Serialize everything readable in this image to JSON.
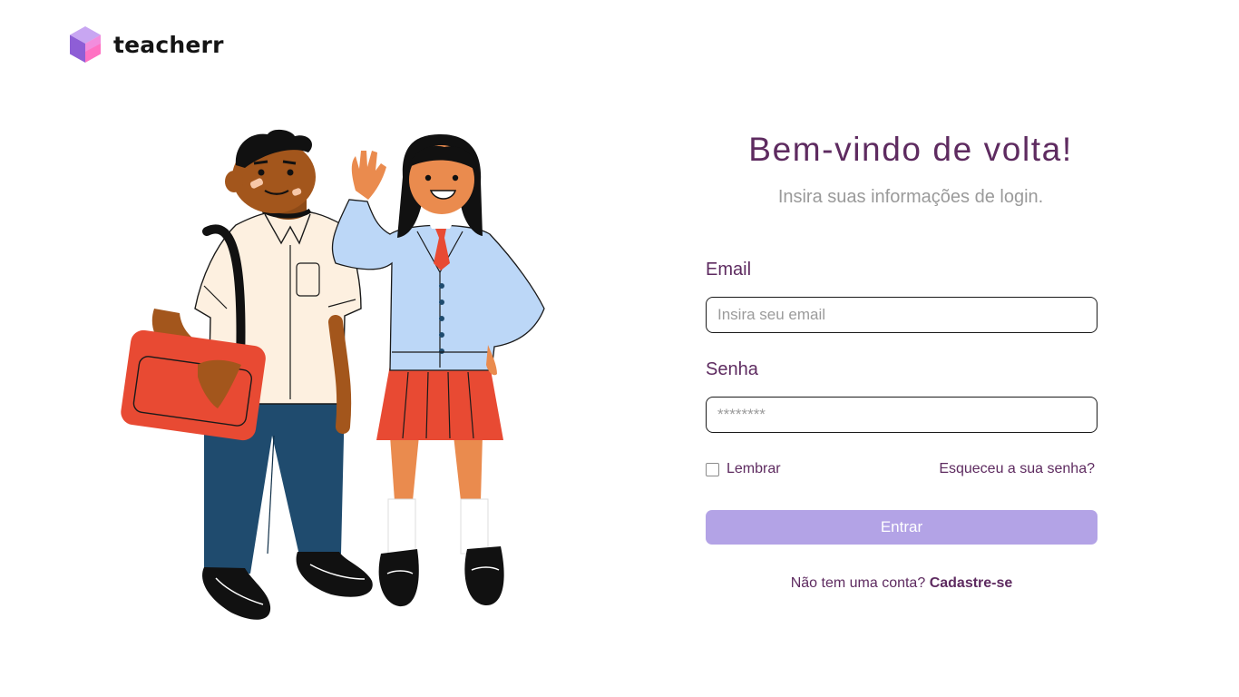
{
  "brand": {
    "name": "teacherr",
    "logo_icon": "cube-logo-icon",
    "logo_colors": [
      "#c39bf0",
      "#8f5fd8",
      "#ff6fc2"
    ]
  },
  "illustration": {
    "description_icon": "students-illustration"
  },
  "login": {
    "title": "Bem-vindo de volta!",
    "subtitle": "Insira suas informações de login.",
    "email_label": "Email",
    "email_placeholder": "Insira seu email",
    "email_value": "",
    "password_label": "Senha",
    "password_placeholder": "********",
    "password_value": "",
    "remember_label": "Lembrar",
    "remember_checked": false,
    "forgot_link": "Esqueceu a sua senha?",
    "submit_label": "Entrar",
    "signup_prompt": "Não tem uma conta?",
    "signup_link": "Cadastre-se"
  },
  "colors": {
    "accent": "#5e2b60",
    "button": "#b3a3e6",
    "muted_text": "#9a9a9a"
  }
}
